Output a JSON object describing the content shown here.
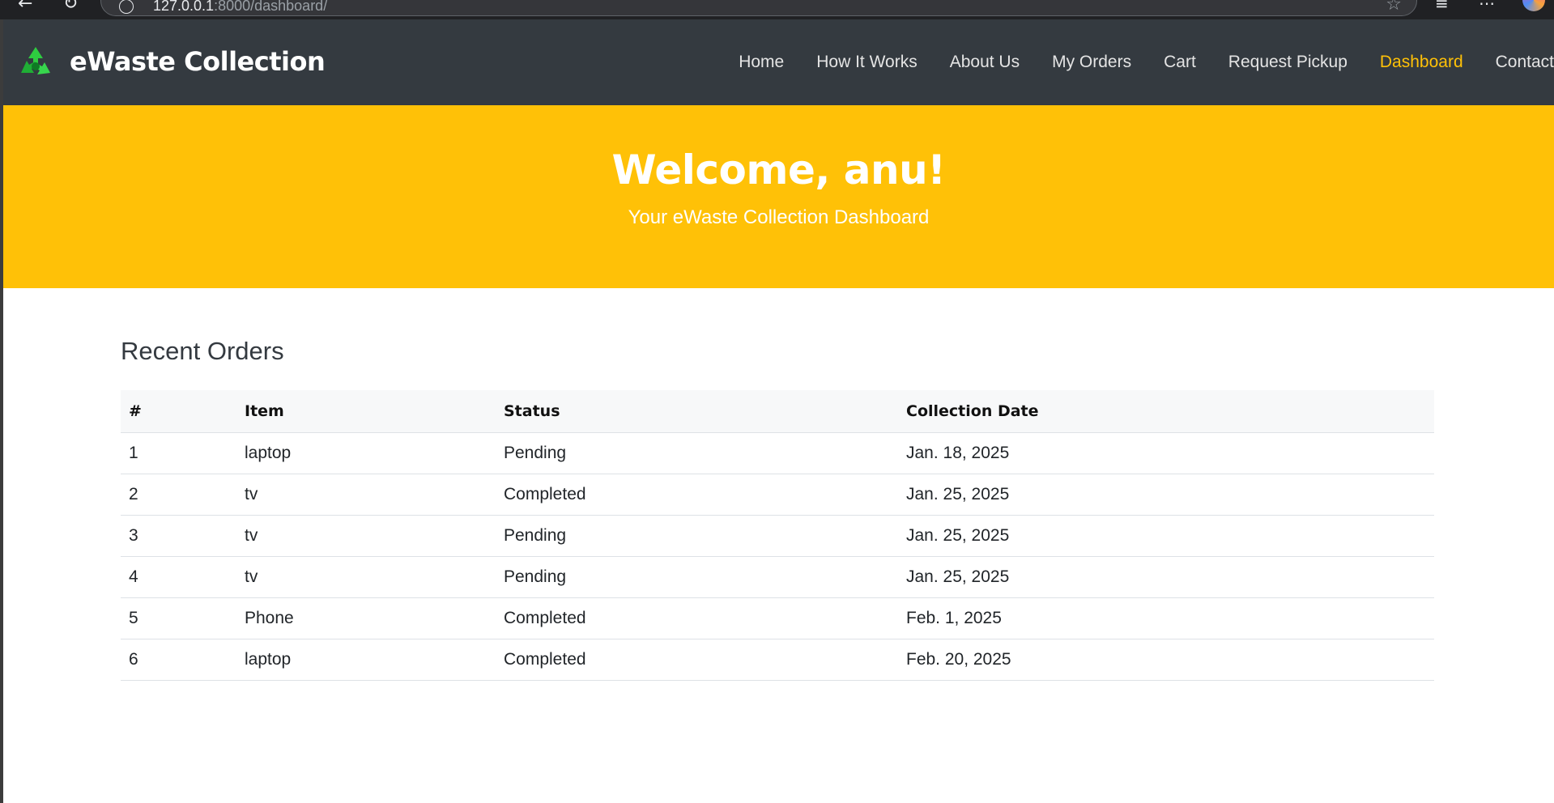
{
  "browser": {
    "url_host": "127.0.0.1",
    "url_path": ":8000/dashboard/",
    "back_icon": "back-arrow-icon",
    "reload_icon": "reload-icon",
    "star_icon": "star-icon"
  },
  "brand": {
    "name": "eWaste Collection",
    "logo_icon": "recycle-logo-icon"
  },
  "nav": {
    "items": [
      {
        "label": "Home",
        "active": false
      },
      {
        "label": "How It Works",
        "active": false
      },
      {
        "label": "About Us",
        "active": false
      },
      {
        "label": "My Orders",
        "active": false
      },
      {
        "label": "Cart",
        "active": false
      },
      {
        "label": "Request Pickup",
        "active": false
      },
      {
        "label": "Dashboard",
        "active": true
      },
      {
        "label": "Contact",
        "active": false
      }
    ]
  },
  "hero": {
    "title": "Welcome, anu!",
    "subtitle": "Your eWaste Collection Dashboard"
  },
  "orders": {
    "title": "Recent Orders",
    "columns": [
      "#",
      "Item",
      "Status",
      "Collection Date"
    ],
    "rows": [
      [
        "1",
        "laptop",
        "Pending",
        "Jan. 18, 2025"
      ],
      [
        "2",
        "tv",
        "Completed",
        "Jan. 25, 2025"
      ],
      [
        "3",
        "tv",
        "Pending",
        "Jan. 25, 2025"
      ],
      [
        "4",
        "tv",
        "Pending",
        "Jan. 25, 2025"
      ],
      [
        "5",
        "Phone",
        "Completed",
        "Feb. 1, 2025"
      ],
      [
        "6",
        "laptop",
        "Completed",
        "Feb. 20, 2025"
      ]
    ]
  },
  "colors": {
    "navbar_bg": "#343a40",
    "hero_bg": "#ffc107",
    "active_link": "#ffc107"
  }
}
